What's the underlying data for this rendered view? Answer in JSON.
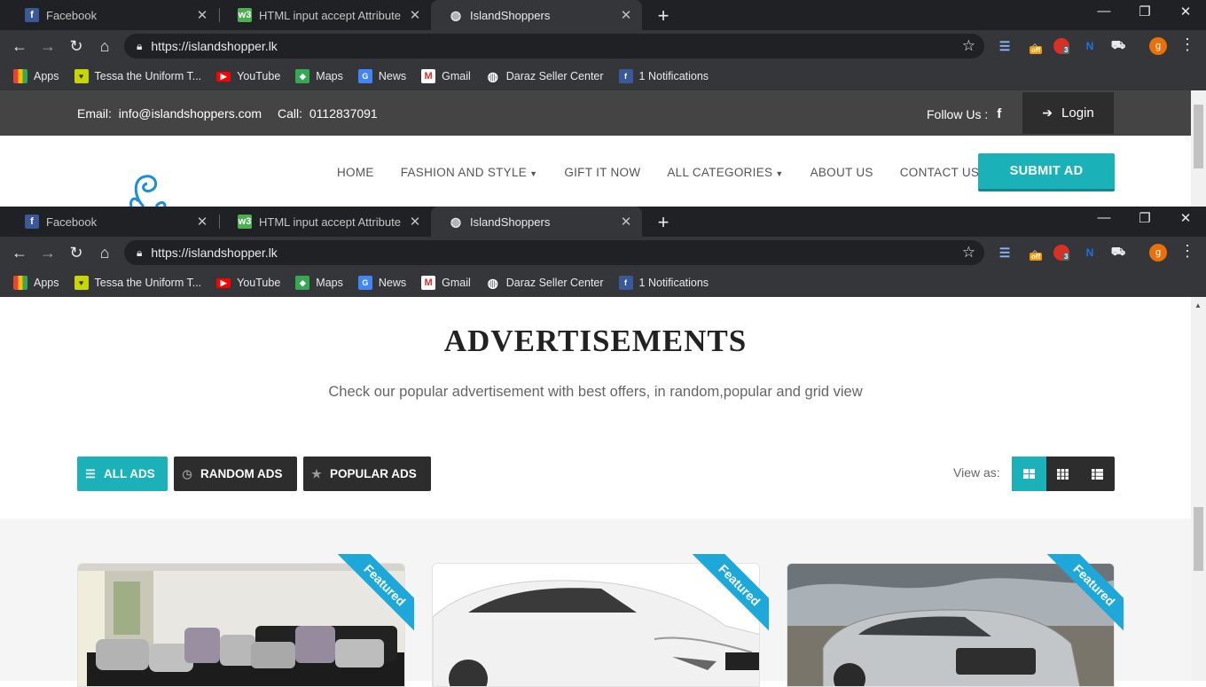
{
  "browser": {
    "tabs": [
      {
        "title": "Facebook",
        "icon": "facebook-icon",
        "color": "#3b5998"
      },
      {
        "title": "HTML input accept Attribute",
        "icon": "w3schools-icon",
        "color": "#4caf50"
      },
      {
        "title": "IslandShoppers",
        "icon": "globe-icon",
        "color": "#e8eaed"
      }
    ],
    "url": "https://islandshopper.lk",
    "bookmarks": [
      {
        "label": "Apps",
        "icon": "apps-grid-icon"
      },
      {
        "label": "Tessa the Uniform T...",
        "icon": "heart-icon"
      },
      {
        "label": "YouTube",
        "icon": "youtube-icon"
      },
      {
        "label": "Maps",
        "icon": "maps-icon"
      },
      {
        "label": "News",
        "icon": "news-icon"
      },
      {
        "label": "Gmail",
        "icon": "gmail-icon"
      },
      {
        "label": "Daraz Seller Center",
        "icon": "globe-icon"
      },
      {
        "label": "1 Notifications",
        "icon": "facebook-icon"
      }
    ],
    "extension_badges": {
      "off": "off",
      "count": "3"
    },
    "avatar_letter": "g"
  },
  "topbar": {
    "email_label": "Email:",
    "email": "info@islandshoppers.com",
    "call_label": "Call:",
    "phone": "0112837091",
    "follow_label": "Follow Us :",
    "facebook_glyph": "f",
    "login_label": "Login"
  },
  "nav": {
    "items": [
      {
        "label": "HOME",
        "dropdown": false
      },
      {
        "label": "FASHION AND STYLE",
        "dropdown": true
      },
      {
        "label": "GIFT IT NOW",
        "dropdown": false
      },
      {
        "label": "ALL CATEGORIES",
        "dropdown": true
      },
      {
        "label": "ABOUT US",
        "dropdown": false
      },
      {
        "label": "CONTACT US",
        "dropdown": false
      }
    ],
    "submit_label": "SUBMIT AD"
  },
  "main": {
    "heading": "ADVERTISEMENTS",
    "subheading": "Check our popular advertisement with best offers, in random,popular and grid view",
    "filters": [
      {
        "label": "ALL ADS",
        "icon": "list-icon",
        "active": true
      },
      {
        "label": "RANDOM ADS",
        "icon": "clock-icon",
        "active": false
      },
      {
        "label": "POPULAR ADS",
        "icon": "star-icon",
        "active": false
      }
    ],
    "view_as_label": "View as:",
    "view_modes": [
      {
        "icon": "large-grid-icon",
        "active": true
      },
      {
        "icon": "small-grid-icon",
        "active": false
      },
      {
        "icon": "list-view-icon",
        "active": false
      }
    ],
    "listings": [
      {
        "image": "sofa-image",
        "badge": "Featured"
      },
      {
        "image": "white-car-image",
        "badge": "Featured"
      },
      {
        "image": "silver-car-image",
        "badge": "Featured"
      }
    ]
  },
  "colors": {
    "accent": "#1ab1b9",
    "dark_button": "#2d2d2d",
    "topbar": "#444444",
    "ribbon": "#1ea8d9"
  }
}
